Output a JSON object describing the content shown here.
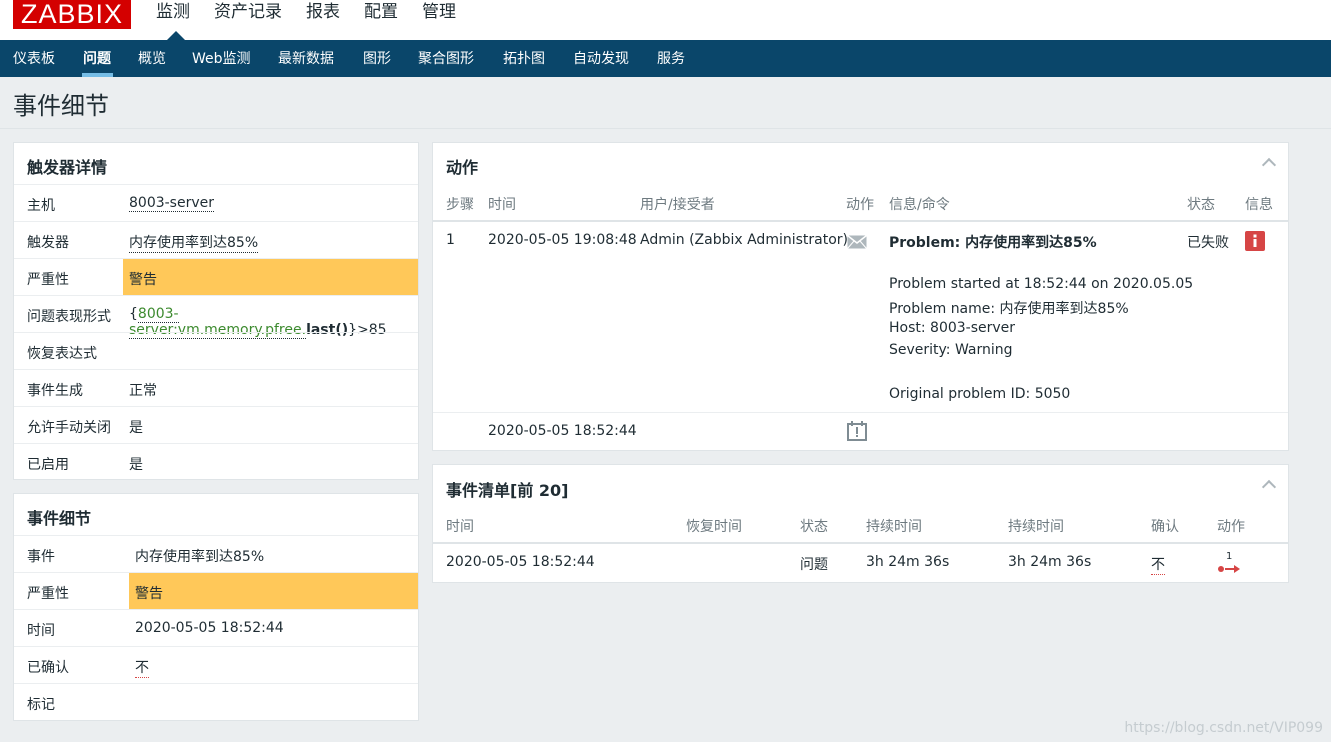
{
  "header": {
    "logo": "ZABBIX",
    "menu": [
      "监测",
      "资产记录",
      "报表",
      "配置",
      "管理"
    ]
  },
  "subnav": {
    "items": [
      "仪表板",
      "问题",
      "概览",
      "Web监测",
      "最新数据",
      "图形",
      "聚合图形",
      "拓扑图",
      "自动发现",
      "服务"
    ],
    "active": "问题"
  },
  "page_title": "事件细节",
  "trigger_details": {
    "title": "触发器详情",
    "host_label": "主机",
    "host_value": "8003-server",
    "trigger_label": "触发器",
    "trigger_value": "内存使用率到达85%",
    "severity_label": "严重性",
    "severity_value": "警告",
    "expr_label": "问题表现形式",
    "expr_open": "{",
    "expr_item": "8003-server:vm.memory.pfree.",
    "expr_func": "last()",
    "expr_close": "}>85",
    "recovery_label": "恢复表达式",
    "event_gen_label": "事件生成",
    "event_gen_value": "正常",
    "manual_close_label": "允许手动关闭",
    "manual_close_value": "是",
    "enabled_label": "已启用",
    "enabled_value": "是"
  },
  "event_details": {
    "title": "事件细节",
    "event_label": "事件",
    "event_value": "内存使用率到达85%",
    "severity_label": "严重性",
    "severity_value": "警告",
    "time_label": "时间",
    "time_value": "2020-05-05 18:52:44",
    "ack_label": "已确认",
    "ack_value": "不",
    "tags_label": "标记"
  },
  "actions": {
    "title": "动作",
    "columns": [
      "步骤",
      "时间",
      "用户/接受者",
      "动作",
      "信息/命令",
      "状态",
      "信息"
    ],
    "row1": {
      "step": "1",
      "time": "2020-05-05 19:08:48",
      "user": "Admin (Zabbix Administrator)",
      "action_icon": "mail-icon",
      "message_title": "Problem: 内存使用率到达85%",
      "message_lines": [
        "Problem started at 18:52:44 on 2020.05.05",
        "Problem name: 内存使用率到达85%",
        "Host: 8003-server",
        "Severity: Warning",
        "Original problem ID: 5050"
      ],
      "status": "已失败",
      "info_icon": "info-icon"
    },
    "row2": {
      "time": "2020-05-05 18:52:44",
      "action_icon": "calendar-alert-icon"
    }
  },
  "event_list": {
    "title": "事件清单[前 20]",
    "columns": [
      "时间",
      "恢复时间",
      "状态",
      "持续时间",
      "持续时间",
      "确认",
      "动作"
    ],
    "rows": [
      {
        "time": "2020-05-05 18:52:44",
        "recovery": "",
        "status": "问题",
        "duration1": "3h 24m 36s",
        "duration2": "3h 24m 36s",
        "ack": "不",
        "action_count": "1"
      }
    ]
  },
  "watermark": "https://blog.csdn.net/VIP099",
  "colors": {
    "accent": "#0a466a",
    "warning": "#ffc859",
    "logo": "#d40000",
    "problem": "#d64545",
    "ok": "#3c8a2e"
  }
}
